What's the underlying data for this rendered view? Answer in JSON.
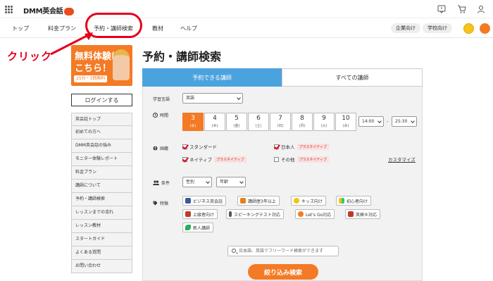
{
  "header": {
    "logo_text": "DMM英会話",
    "icons": [
      "apps-grid-icon",
      "notice-icon",
      "cart-icon",
      "user-icon"
    ]
  },
  "nav": {
    "items": [
      "トップ",
      "料金プラン",
      "予約・講師検索",
      "教材",
      "ヘルプ"
    ],
    "corporate": "企業向け",
    "school": "学校向け"
  },
  "annotation": {
    "click_label": "クリック",
    "color": "#e4001b"
  },
  "banner": {
    "line1": "無料体験は",
    "line2": "こちら！",
    "sub": "25分・3回無料"
  },
  "sidebar": {
    "login": "ログインする",
    "items": [
      "英会話トップ",
      "初めての方へ",
      "DMM英会話の強み",
      "モニター体験レポート",
      "料金プラン",
      "講師について",
      "予約・講師検索",
      "レッスンまでの流れ",
      "レッスン教材",
      "スタートガイド",
      "よくある質問",
      "お問い合わせ"
    ]
  },
  "main": {
    "title": "予約・講師検索",
    "tabs": [
      "予約できる講師",
      "すべての講師"
    ],
    "language_label": "学習言語",
    "language_value": "英語",
    "time_label": "時間",
    "days": [
      {
        "num": "3",
        "dow": "(水)"
      },
      {
        "num": "4",
        "dow": "(木)"
      },
      {
        "num": "5",
        "dow": "(金)"
      },
      {
        "num": "6",
        "dow": "(土)"
      },
      {
        "num": "7",
        "dow": "(日)"
      },
      {
        "num": "8",
        "dow": "(月)"
      },
      {
        "num": "9",
        "dow": "(火)"
      },
      {
        "num": "10",
        "dow": "(水)"
      }
    ],
    "time_from": "14:00",
    "time_sep": "-",
    "time_to": "25:30",
    "nationality_label": "国籍",
    "nat_standard": "スタンダード",
    "nat_native": "ネイティブ",
    "nat_japanese": "日本人",
    "nat_other": "その他",
    "plus_native": "プラスネイティブ",
    "customize": "カスタマイズ",
    "condition_label": "条件",
    "gender": "性別",
    "age": "年齢",
    "feature_label": "特徴",
    "features": [
      "ビジネス英会話",
      "講師歴3年以上",
      "キッズ向け",
      "初心者向け",
      "上級者向け",
      "スピーキングテスト対応",
      "Let's Go対応",
      "英検®対応",
      "新人講師"
    ],
    "search_placeholder": "日本語、英語でフリーワード検索ができます",
    "submit": "絞り込み検索"
  },
  "colors": {
    "accent_orange": "#f47a25",
    "tab_blue": "#4aa3df",
    "highlight_red": "#e4001b"
  }
}
